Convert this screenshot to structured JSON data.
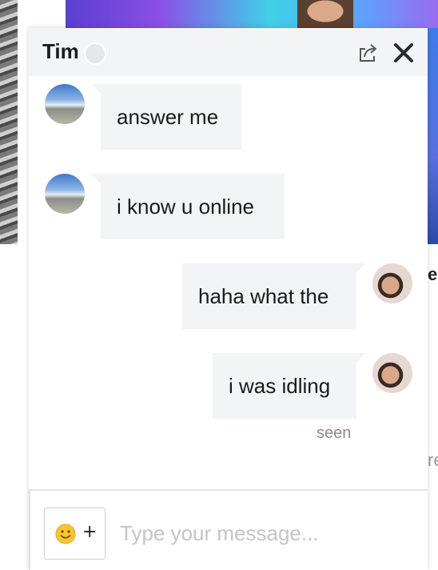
{
  "chat": {
    "title": "Tim",
    "messages": [
      {
        "side": "in",
        "text": "answer me"
      },
      {
        "side": "in",
        "text": "i know u online"
      },
      {
        "side": "out",
        "text": "haha what the"
      },
      {
        "side": "out",
        "text": "i was idling"
      }
    ],
    "read_receipt": "seen"
  },
  "composer": {
    "placeholder": "Type your message...",
    "emoji_plus": "+"
  },
  "icons": {
    "presence": "presence-dot-icon",
    "share": "share-icon",
    "close": "close-icon",
    "emoji": "smiley-icon"
  },
  "colors": {
    "header_bg": "#f3f4f6",
    "bubble_bg": "#f3f4f6",
    "text": "#1a1a1a",
    "seen": "#8a8a8a",
    "placeholder": "#c4c4c4"
  }
}
